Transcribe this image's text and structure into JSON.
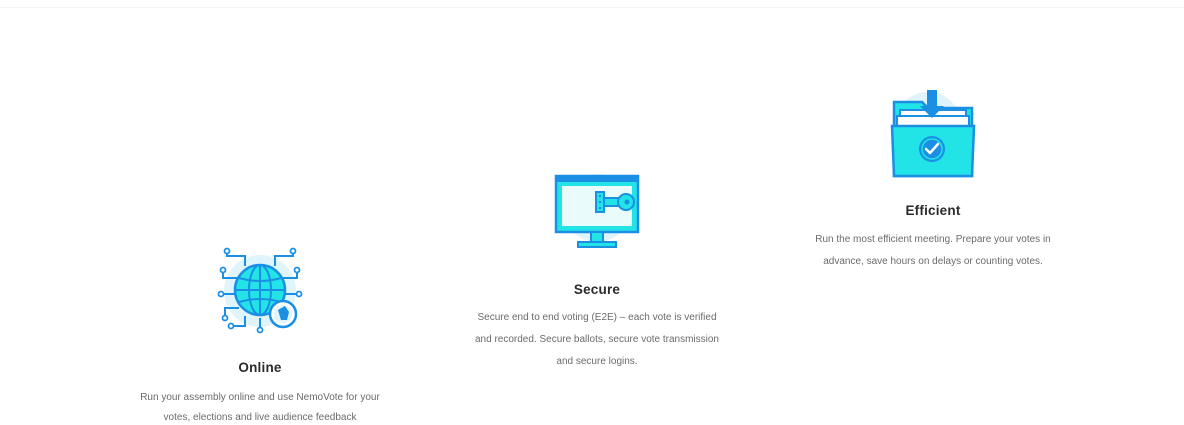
{
  "features": [
    {
      "title": "Online",
      "description_line1": "Run your assembly online and use NemoVote for your",
      "description_line2": "votes, elections and live audience feedback",
      "icon": "globe-network-icon"
    },
    {
      "title": "Secure",
      "description_line1": "Secure end to end voting (E2E) – each vote is verified",
      "description_line2": "and recorded. Secure ballots, secure vote transmission",
      "description_line3": "and secure logins.",
      "icon": "monitor-key-icon"
    },
    {
      "title": "Efficient",
      "description_line1": "Run the most efficient meeting. Prepare your votes in",
      "description_line2": "advance, save hours on delays or counting votes.",
      "icon": "folder-download-check-icon"
    }
  ],
  "colors": {
    "accent_cyan": "#22e3e6",
    "accent_blue": "#1a8fe3",
    "light_blue": "#dff4fb",
    "title": "#2b2b2b",
    "text": "#6b6b6b"
  }
}
